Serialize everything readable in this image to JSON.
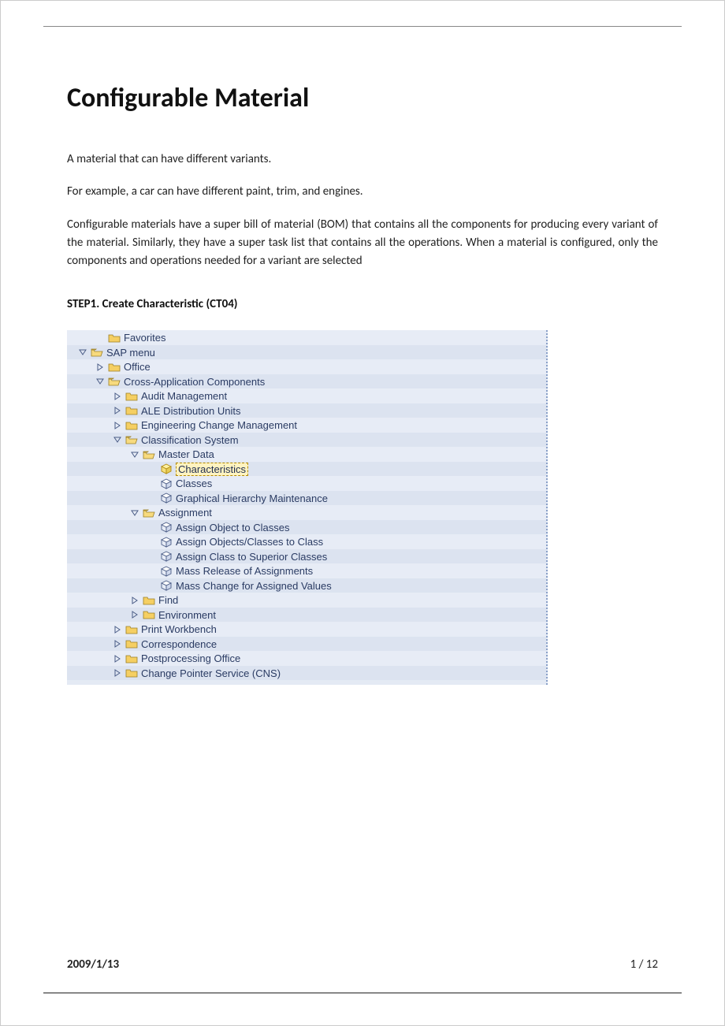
{
  "document": {
    "title": "Configurable Material",
    "intro": "A material that can have different variants.",
    "body1": "For example, a car can have different paint, trim, and engines.",
    "body2": "Configurable materials have a super bill of material (BOM) that contains all the components for producing every variant of the material. Similarly, they have a super task list that contains all the operations. When a material is configured, only the components and operations needed for a variant are selected",
    "step_heading": "STEP1. Create Characteristic (CT04)"
  },
  "tree": {
    "items": [
      {
        "indent": 1,
        "expander": "none",
        "icon": "folder-closed",
        "label": "Favorites",
        "selected": false
      },
      {
        "indent": 0,
        "expander": "down",
        "icon": "folder-open",
        "label": "SAP menu",
        "selected": false
      },
      {
        "indent": 1,
        "expander": "right",
        "icon": "folder-closed",
        "label": "Office",
        "selected": false
      },
      {
        "indent": 1,
        "expander": "down",
        "icon": "folder-open",
        "label": "Cross-Application Components",
        "selected": false
      },
      {
        "indent": 2,
        "expander": "right",
        "icon": "folder-closed",
        "label": "Audit Management",
        "selected": false
      },
      {
        "indent": 2,
        "expander": "right",
        "icon": "folder-closed",
        "label": "ALE Distribution Units",
        "selected": false
      },
      {
        "indent": 2,
        "expander": "right",
        "icon": "folder-closed",
        "label": "Engineering Change Management",
        "selected": false
      },
      {
        "indent": 2,
        "expander": "down",
        "icon": "folder-open",
        "label": "Classification System",
        "selected": false
      },
      {
        "indent": 3,
        "expander": "down",
        "icon": "folder-open",
        "label": "Master Data",
        "selected": false
      },
      {
        "indent": 4,
        "expander": "none",
        "icon": "cube-sel",
        "label": "Characteristics",
        "selected": true
      },
      {
        "indent": 4,
        "expander": "none",
        "icon": "cube",
        "label": "Classes",
        "selected": false
      },
      {
        "indent": 4,
        "expander": "none",
        "icon": "cube",
        "label": "Graphical Hierarchy Maintenance",
        "selected": false
      },
      {
        "indent": 3,
        "expander": "down",
        "icon": "folder-open",
        "label": "Assignment",
        "selected": false
      },
      {
        "indent": 4,
        "expander": "none",
        "icon": "cube",
        "label": "Assign Object to Classes",
        "selected": false
      },
      {
        "indent": 4,
        "expander": "none",
        "icon": "cube",
        "label": "Assign Objects/Classes to Class",
        "selected": false
      },
      {
        "indent": 4,
        "expander": "none",
        "icon": "cube",
        "label": "Assign Class to Superior Classes",
        "selected": false
      },
      {
        "indent": 4,
        "expander": "none",
        "icon": "cube",
        "label": "Mass Release of Assignments",
        "selected": false
      },
      {
        "indent": 4,
        "expander": "none",
        "icon": "cube",
        "label": "Mass Change for Assigned Values",
        "selected": false
      },
      {
        "indent": 3,
        "expander": "right",
        "icon": "folder-closed",
        "label": "Find",
        "selected": false
      },
      {
        "indent": 3,
        "expander": "right",
        "icon": "folder-closed",
        "label": "Environment",
        "selected": false
      },
      {
        "indent": 2,
        "expander": "right",
        "icon": "folder-closed",
        "label": "Print Workbench",
        "selected": false
      },
      {
        "indent": 2,
        "expander": "right",
        "icon": "folder-closed",
        "label": "Correspondence",
        "selected": false
      },
      {
        "indent": 2,
        "expander": "right",
        "icon": "folder-closed",
        "label": "Postprocessing Office",
        "selected": false
      },
      {
        "indent": 2,
        "expander": "right",
        "icon": "folder-closed",
        "label": "Change Pointer Service (CNS)",
        "selected": false
      }
    ]
  },
  "footer": {
    "date": "2009/1/13",
    "page": "1 / 12"
  }
}
